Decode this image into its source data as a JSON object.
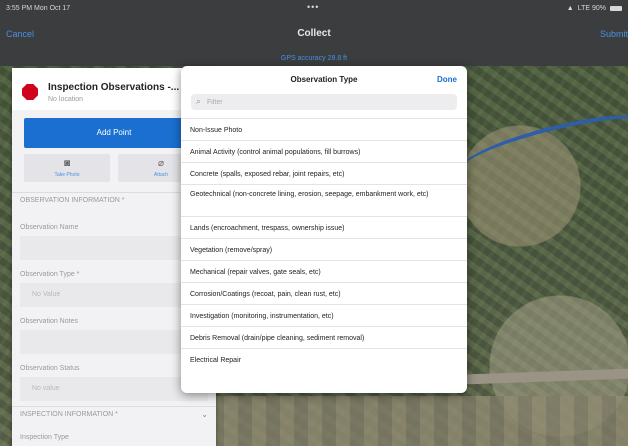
{
  "status_bar": {
    "time": "3:55 PM  Mon Oct 17",
    "dots": "•••",
    "network": "LTE 90%"
  },
  "nav": {
    "cancel_label": "Cancel",
    "title": "Collect",
    "submit_label": "Submit"
  },
  "gps_text": "GPS accuracy 28.8 ft",
  "panel": {
    "title": "Inspection Observations -...",
    "subtitle": "No location",
    "add_point_label": "Add Point",
    "take_photo_label": "Take Photo",
    "attach_label": "Attach",
    "section_observation": "OBSERVATION INFORMATION *",
    "observation_name_label": "Observation Name",
    "observation_type_label": "Observation Type *",
    "observation_type_value": "No Value",
    "observation_notes_label": "Observation Notes",
    "observation_status_label": "Observation Status",
    "observation_status_value": "No value",
    "section_inspection": "INSPECTION INFORMATION *",
    "inspection_type_label": "Inspection Type"
  },
  "popover": {
    "title": "Observation Type",
    "done_label": "Done",
    "filter_placeholder": "Filter",
    "options": [
      "Non-Issue Photo",
      "Animal Activity (control animal populations, fill burrows)",
      "Concrete (spalls, exposed rebar, joint repairs, etc)",
      "Geotechnical (non-concrete lining, erosion, seepage, embankment work, etc)",
      "Lands (encroachment, trespass, ownership issue)",
      "Vegetation (remove/spray)",
      "Mechanical (repair valves, gate seals, etc)",
      "Corrosion/Coatings (recoat, pain, clean rust, etc)",
      "Investigation (monitoring, instrumentation, etc)",
      "Debris Removal (drain/pipe cleaning, sediment removal)",
      "Electrical Repair"
    ]
  },
  "colors": {
    "accent": "#1a6fd0",
    "link": "#4a90e2",
    "alert": "#d0021b",
    "bar": "#3b3d3f"
  }
}
